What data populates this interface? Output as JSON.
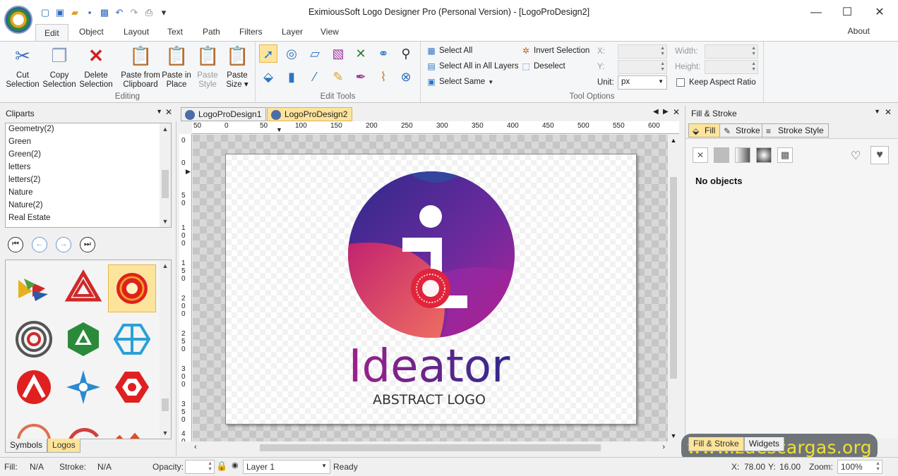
{
  "window": {
    "title": "EximiousSoft Logo Designer Pro (Personal Version) - [LogoProDesign2]",
    "minimize": "—",
    "maximize": "☐",
    "close": "✕"
  },
  "quick_access": [
    "new-icon",
    "open-icon",
    "folder-icon",
    "save-icon",
    "save-all-icon",
    "undo-icon",
    "redo-icon",
    "print-icon",
    "customize-icon"
  ],
  "menu_tabs": [
    "Edit",
    "Object",
    "Layout",
    "Text",
    "Path",
    "Filters",
    "Layer",
    "View"
  ],
  "about": "About",
  "ribbon": {
    "editing": {
      "label": "Editing",
      "buttons": [
        {
          "label1": "Cut",
          "label2": "Selection"
        },
        {
          "label1": "Copy",
          "label2": "Selection"
        },
        {
          "label1": "Delete",
          "label2": "Selection"
        },
        {
          "label1": "Paste from",
          "label2": "Clipboard"
        },
        {
          "label1": "Paste in",
          "label2": "Place"
        },
        {
          "label1": "Paste",
          "label2": "Style"
        },
        {
          "label1": "Paste",
          "label2": "Size ▾"
        }
      ]
    },
    "edit_tools": {
      "label": "Edit Tools"
    },
    "tool_options": {
      "label": "Tool Options",
      "select_all": "Select All",
      "select_all_layers": "Select All in All Layers",
      "select_same": "Select Same",
      "invert_selection": "Invert Selection",
      "deselect": "Deselect",
      "x_label": "X:",
      "y_label": "Y:",
      "unit_label": "Unit:",
      "unit_value": "px",
      "width_label": "Width:",
      "height_label": "Height:",
      "keep_aspect": "Keep Aspect Ratio"
    }
  },
  "cliparts": {
    "title": "Cliparts",
    "items": [
      "Geometry(2)",
      "Green",
      "Green(2)",
      "letters",
      "letters(2)",
      "Nature",
      "Nature(2)",
      "Real Estate"
    ],
    "tabs": [
      "Symbols",
      "Logos"
    ]
  },
  "documents": {
    "tabs": [
      "LogoProDesign1",
      "LogoProDesign2"
    ],
    "ruler_h": [
      "50",
      "0",
      "50",
      "100",
      "150",
      "200",
      "250",
      "300",
      "350",
      "400",
      "450",
      "500",
      "550",
      "600"
    ],
    "ruler_v": [
      "0",
      "0",
      "5 0",
      "1 0 0",
      "1 5 0",
      "2 0 0",
      "2 5 0",
      "3 0 0",
      "3 5 0",
      "4 0"
    ]
  },
  "design": {
    "main_text": "Ideator",
    "sub_text": "ABSTRACT LOGO"
  },
  "fill_stroke": {
    "title": "Fill & Stroke",
    "tabs": [
      "Fill",
      "Stroke",
      "Stroke Style"
    ],
    "no_objects": "No objects",
    "bottom_tabs": [
      "Fill & Stroke",
      "Widgets"
    ]
  },
  "watermark": "www.zdescargas.org",
  "status": {
    "fill_label": "Fill:",
    "fill_value": "N/A",
    "stroke_label": "Stroke:",
    "stroke_value": "N/A",
    "opacity_label": "Opacity:",
    "layer": "Layer 1",
    "state": "Ready",
    "x_label": "X:",
    "x_value": "78.00",
    "y_label": "Y:",
    "y_value": "16.00",
    "zoom_label": "Zoom:",
    "zoom_value": "100%"
  },
  "colors": {
    "accent_tab": "#fde49b",
    "logo_purple": "#3a2a8a",
    "logo_magenta": "#a0229a",
    "logo_red": "#e0243a"
  }
}
